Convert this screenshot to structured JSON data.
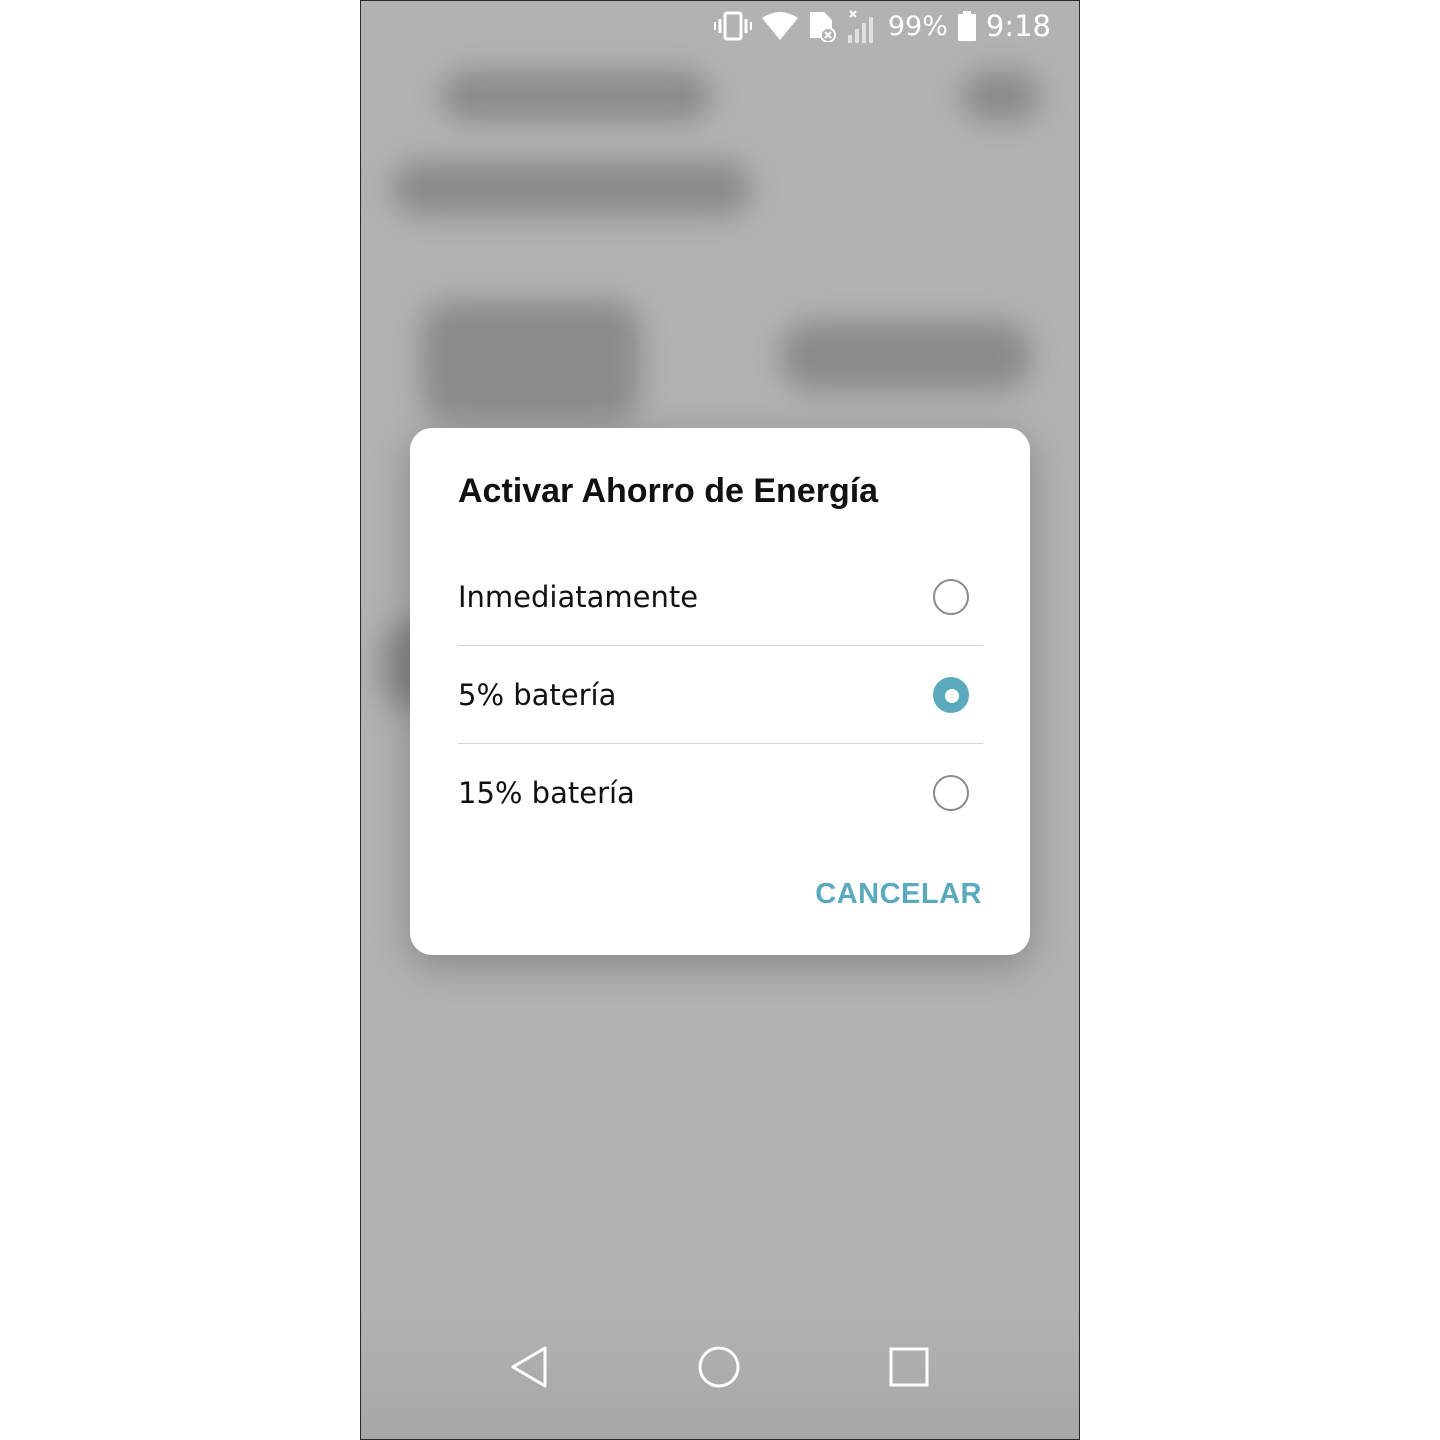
{
  "status_bar": {
    "battery_percent": "99%",
    "time": "9:18",
    "icons": [
      "vibrate-icon",
      "wifi-icon",
      "sim-error-icon",
      "signal-icon",
      "battery-icon"
    ]
  },
  "dialog": {
    "title": "Activar Ahorro de Energía",
    "options": [
      {
        "label": "Inmediatamente",
        "selected": false
      },
      {
        "label": "5% batería",
        "selected": true
      },
      {
        "label": "15% batería",
        "selected": false
      }
    ],
    "cancel_label": "CANCELAR"
  },
  "nav_bar": {
    "icons": [
      "back-icon",
      "home-icon",
      "recents-icon"
    ]
  },
  "colors": {
    "accent": "#5aa9bd",
    "scrim": "#b2b2b2"
  }
}
